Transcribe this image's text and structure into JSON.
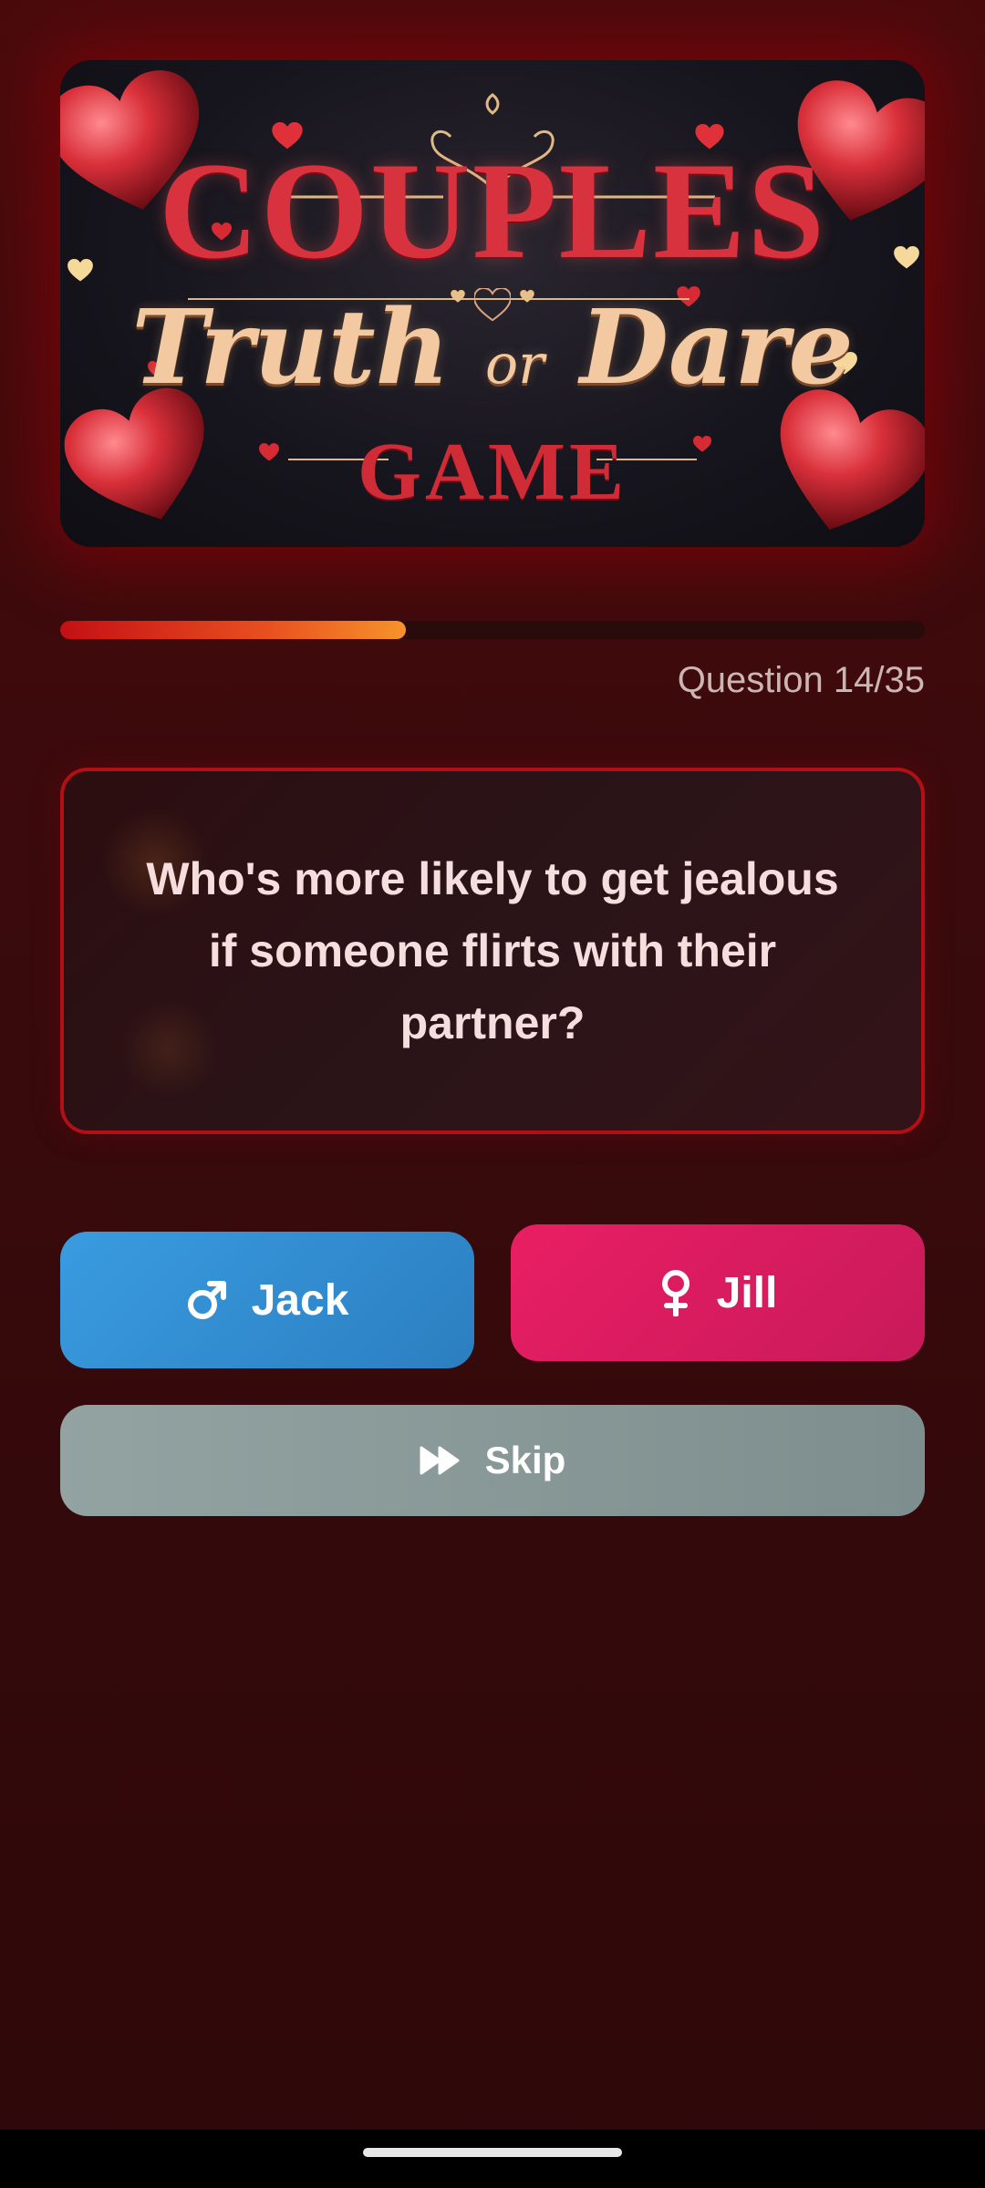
{
  "banner": {
    "title_line1": "COUPLES",
    "title_line2_a": "Truth",
    "title_line2_or": "or",
    "title_line2_b": "Dare",
    "title_line3": "GAME"
  },
  "progress": {
    "current": 14,
    "total": 35,
    "label": "Question 14/35"
  },
  "question": {
    "text": "Who's more likely to get jealous if someone flirts with their partner?"
  },
  "buttons": {
    "player1": {
      "label": "Jack",
      "icon": "male-symbol-icon",
      "color": "#3a9be0"
    },
    "player2": {
      "label": "Jill",
      "icon": "female-symbol-icon",
      "color": "#e91e63"
    },
    "skip": {
      "label": "Skip",
      "icon": "fast-forward-icon"
    }
  },
  "colors": {
    "background": "#3a0a0c",
    "accent": "#b01016",
    "progress_start": "#c40f14",
    "progress_end": "#f7932b"
  }
}
